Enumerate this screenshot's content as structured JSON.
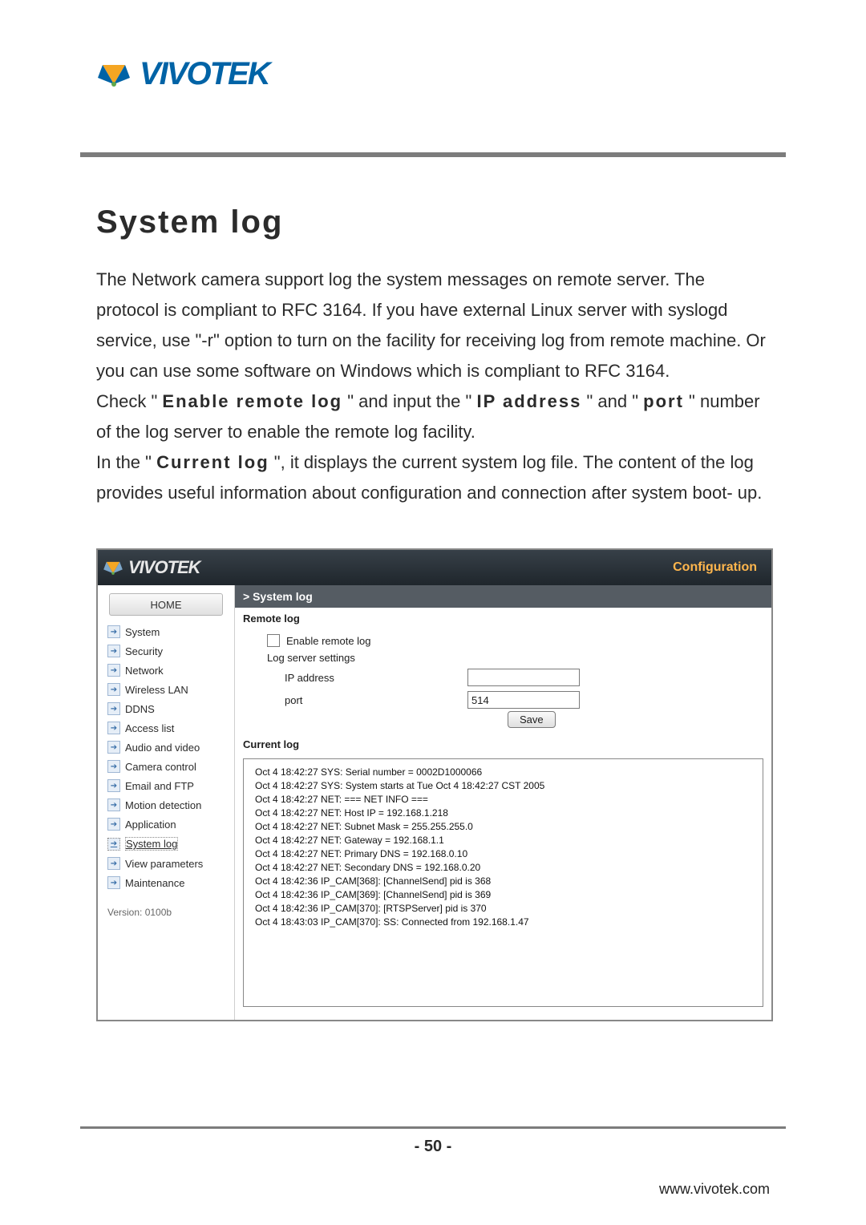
{
  "page": {
    "title": "System log",
    "number": "- 50 -",
    "footer_url": "www.vivotek.com"
  },
  "logo": {
    "brand": "VIVOTEK"
  },
  "body_paragraphs": {
    "p1_a": "The Network camera support log the system messages on remote server. The protocol is compliant to RFC 3164. If you have external Linux server with syslogd service, use \"-r\" option to turn on the facility for receiving log from remote machine. Or you can use some software on Windows which is compliant to RFC 3164.",
    "p2_a": "Check \"",
    "p2_b_strong": "Enable remote log",
    "p2_c": "\" and input the \"",
    "p2_d_strong": "IP address",
    "p2_e": "\" and \"",
    "p2_f_strong": "port",
    "p2_g": "\" number of the log server to enable the remote log facility.",
    "p3_a": "In the  \"",
    "p3_b_strong": "Current log",
    "p3_c": "\", it displays the current system log file. The content of the log provides useful information about configuration and connection after system boot- up."
  },
  "ui": {
    "brand": "VIVOTEK",
    "config_link": "Configuration",
    "home_label": "HOME",
    "sidebar_items": [
      "System",
      "Security",
      "Network",
      "Wireless LAN",
      "DDNS",
      "Access list",
      "Audio and video",
      "Camera control",
      "Email and FTP",
      "Motion detection",
      "Application",
      "System log",
      "View parameters",
      "Maintenance"
    ],
    "sidebar_current_index": 11,
    "version": "Version: 0100b",
    "crumb": "> System log",
    "remote_log_section": "Remote log",
    "enable_remote_log": "Enable remote log",
    "log_server_settings": "Log server settings",
    "ip_label": "IP address",
    "ip_value": "",
    "port_label": "port",
    "port_value": "514",
    "save_label": "Save",
    "current_log_section": "Current log",
    "log_lines": "Oct 4 18:42:27 SYS: Serial number = 0002D1000066\nOct 4 18:42:27 SYS: System starts at Tue Oct 4 18:42:27 CST 2005\nOct 4 18:42:27 NET: === NET INFO ===\nOct 4 18:42:27 NET: Host IP = 192.168.1.218\nOct 4 18:42:27 NET: Subnet Mask = 255.255.255.0\nOct 4 18:42:27 NET: Gateway = 192.168.1.1\nOct 4 18:42:27 NET: Primary DNS = 192.168.0.10\nOct 4 18:42:27 NET: Secondary DNS = 192.168.0.20\nOct 4 18:42:36 IP_CAM[368]: [ChannelSend] pid is 368\nOct 4 18:42:36 IP_CAM[369]: [ChannelSend] pid is 369\nOct 4 18:42:36 IP_CAM[370]: [RTSPServer] pid is 370\nOct 4 18:43:03 IP_CAM[370]: SS: Connected from 192.168.1.47"
  }
}
